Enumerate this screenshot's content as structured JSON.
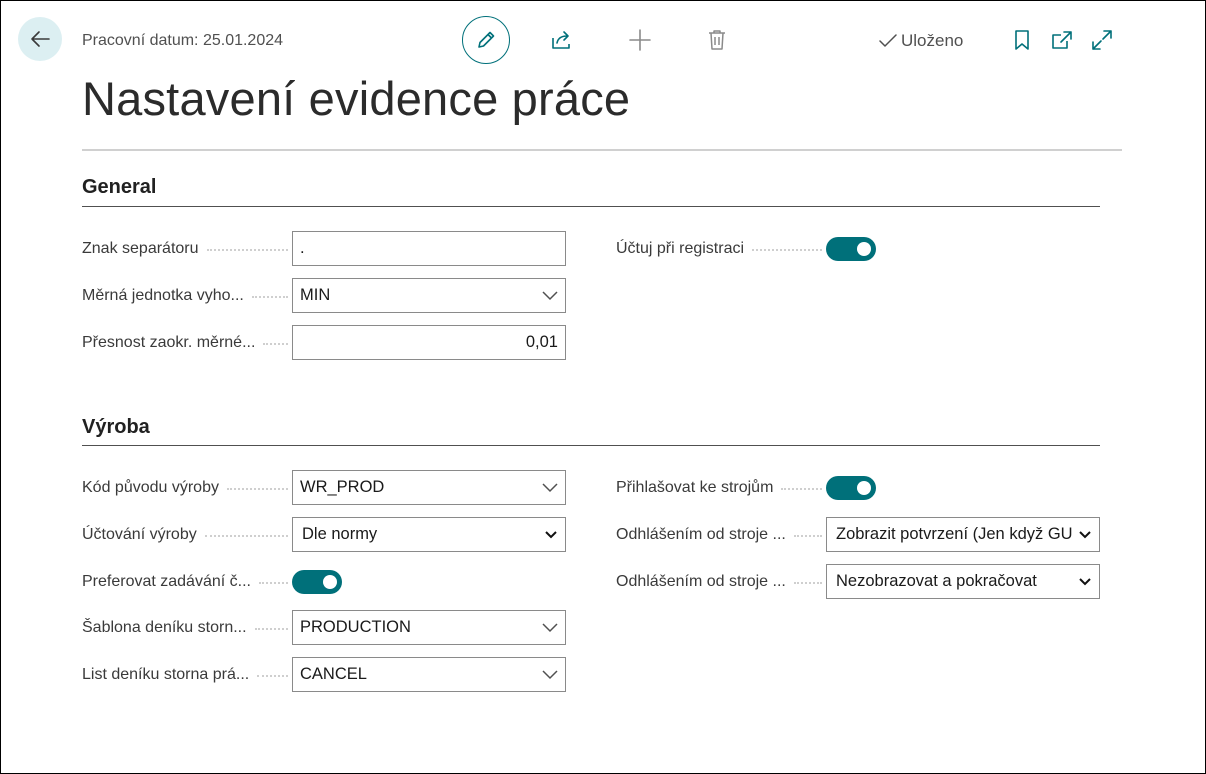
{
  "header": {
    "work_date": "Pracovní datum: 25.01.2024",
    "saved_label": "Uloženo",
    "icons": {
      "back": "arrow-left-icon",
      "edit": "pencil-icon",
      "share": "share-icon",
      "add": "plus-icon",
      "delete": "trash-icon",
      "saved": "checkmark-icon",
      "bookmark": "bookmark-icon",
      "popout": "open-new-window-icon",
      "expand": "expand-icon"
    }
  },
  "page": {
    "title": "Nastavení evidence práce"
  },
  "colors": {
    "accent": "#00707a",
    "back_button_bg": "#dceff2"
  },
  "general": {
    "heading": "General",
    "fields": {
      "separator": {
        "label": "Znak separátoru",
        "value": "."
      },
      "uom": {
        "label": "Měrná jednotka vyho...",
        "value": "MIN"
      },
      "rounding": {
        "label": "Přesnost zaokr. měrné...",
        "value": "0,01"
      },
      "post_on_registration": {
        "label": "Účtuj při registraci",
        "value": true
      }
    }
  },
  "production": {
    "heading": "Výroba",
    "fields": {
      "source_code": {
        "label": "Kód původu výroby",
        "value": "WR_PROD"
      },
      "posting": {
        "label": "Účtování výroby",
        "value": "Dle normy"
      },
      "prefer_entry": {
        "label": "Preferovat zadávání č...",
        "value": true
      },
      "reversal_template": {
        "label": "Šablona deníku storn...",
        "value": "PRODUCTION"
      },
      "reversal_batch": {
        "label": "List deníku storna prá...",
        "value": "CANCEL"
      },
      "login_machines": {
        "label": "Přihlašovat ke strojům",
        "value": true
      },
      "logout_1": {
        "label": "Odhlášením od stroje ...",
        "value": "Zobrazit potvrzení (Jen když GU"
      },
      "logout_2": {
        "label": "Odhlášením od stroje ...",
        "value": "Nezobrazovat a pokračovat"
      }
    }
  }
}
